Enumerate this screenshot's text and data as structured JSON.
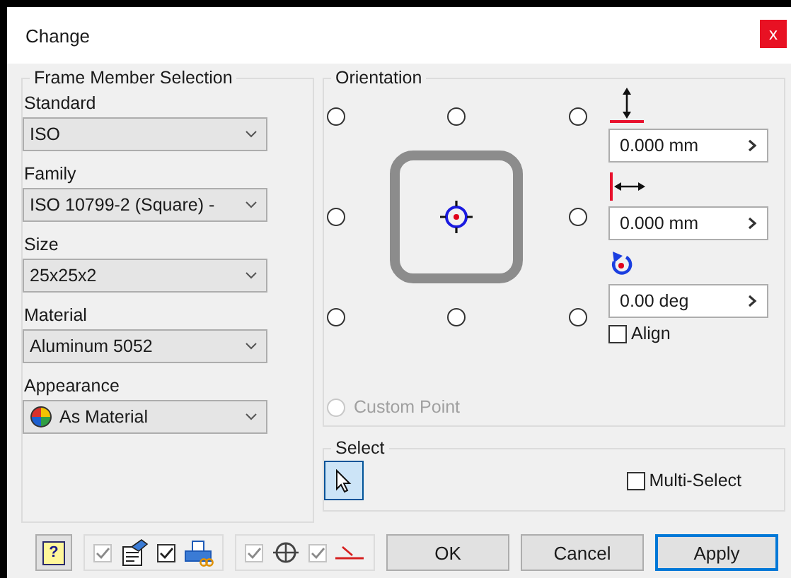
{
  "window": {
    "title": "Change",
    "close_label": "x"
  },
  "frame_member_selection": {
    "title": "Frame Member Selection",
    "fields": [
      {
        "label": "Standard",
        "value": "ISO",
        "kind": "plain"
      },
      {
        "label": "Family",
        "value": "ISO 10799-2 (Square) -",
        "kind": "plain"
      },
      {
        "label": "Size",
        "value": "25x25x2",
        "kind": "plain"
      },
      {
        "label": "Material",
        "value": "Aluminum 5052",
        "kind": "plain"
      },
      {
        "label": "Appearance",
        "value": "As Material",
        "kind": "appearance"
      }
    ]
  },
  "orientation": {
    "title": "Orientation",
    "anchors": [
      {
        "selected": false
      },
      {
        "selected": false
      },
      {
        "selected": false
      },
      {
        "selected": false
      },
      {
        "selected": false
      },
      {
        "selected": false
      },
      {
        "selected": false
      },
      {
        "selected": false
      }
    ],
    "custom_point": {
      "label": "Custom Point",
      "selected": false,
      "disabled": true
    },
    "offsets": [
      {
        "kind": "vertical",
        "value": "0.000 mm"
      },
      {
        "kind": "horizontal",
        "value": "0.000 mm"
      },
      {
        "kind": "rotation",
        "value": "0.00 deg"
      }
    ],
    "align": {
      "label": "Align",
      "checked": false
    }
  },
  "select": {
    "title": "Select",
    "select_tool": {
      "selected": true
    },
    "multi_select": {
      "label": "Multi-Select",
      "checked": false
    }
  },
  "toolbar": {
    "help_label": "?",
    "groups": [
      [
        {
          "kind": "properties",
          "checked": true,
          "disabled": true
        },
        {
          "kind": "printer",
          "checked": true,
          "disabled": false
        }
      ],
      [
        {
          "kind": "centroid",
          "checked": true,
          "disabled": true
        },
        {
          "kind": "miter",
          "checked": true,
          "disabled": true
        }
      ]
    ]
  },
  "buttons": [
    {
      "label": "OK",
      "default": false
    },
    {
      "label": "Cancel",
      "default": false
    },
    {
      "label": "Apply",
      "default": true
    }
  ]
}
